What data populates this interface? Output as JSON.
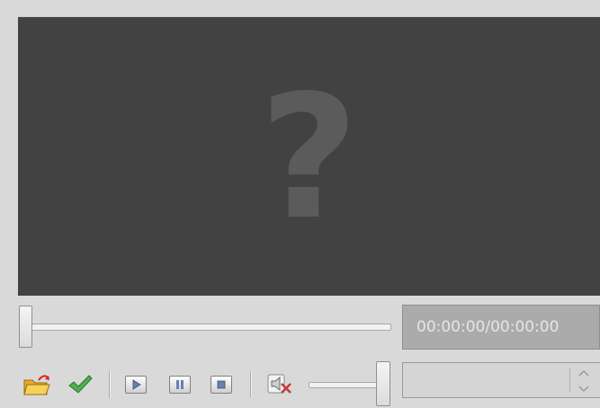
{
  "video": {
    "placeholder_glyph": "?"
  },
  "seek": {
    "position_fraction": 0.0
  },
  "time": {
    "display": "00:00:00/00:00:00"
  },
  "toolbar": {
    "open_icon": "open-folder-icon",
    "apply_icon": "checkmark-icon",
    "play_icon": "play-icon",
    "pause_icon": "pause-icon",
    "stop_icon": "stop-icon",
    "mute_icon": "speaker-muted-icon"
  },
  "volume": {
    "level_fraction": 1.0
  },
  "spinbox": {
    "value": "",
    "placeholder": ""
  },
  "colors": {
    "window_bg": "#d9d9d9",
    "video_bg": "#424242",
    "apply_green": "#3aa53a",
    "mute_red": "#d23a3a",
    "folder_yellow": "#f0b93a"
  }
}
